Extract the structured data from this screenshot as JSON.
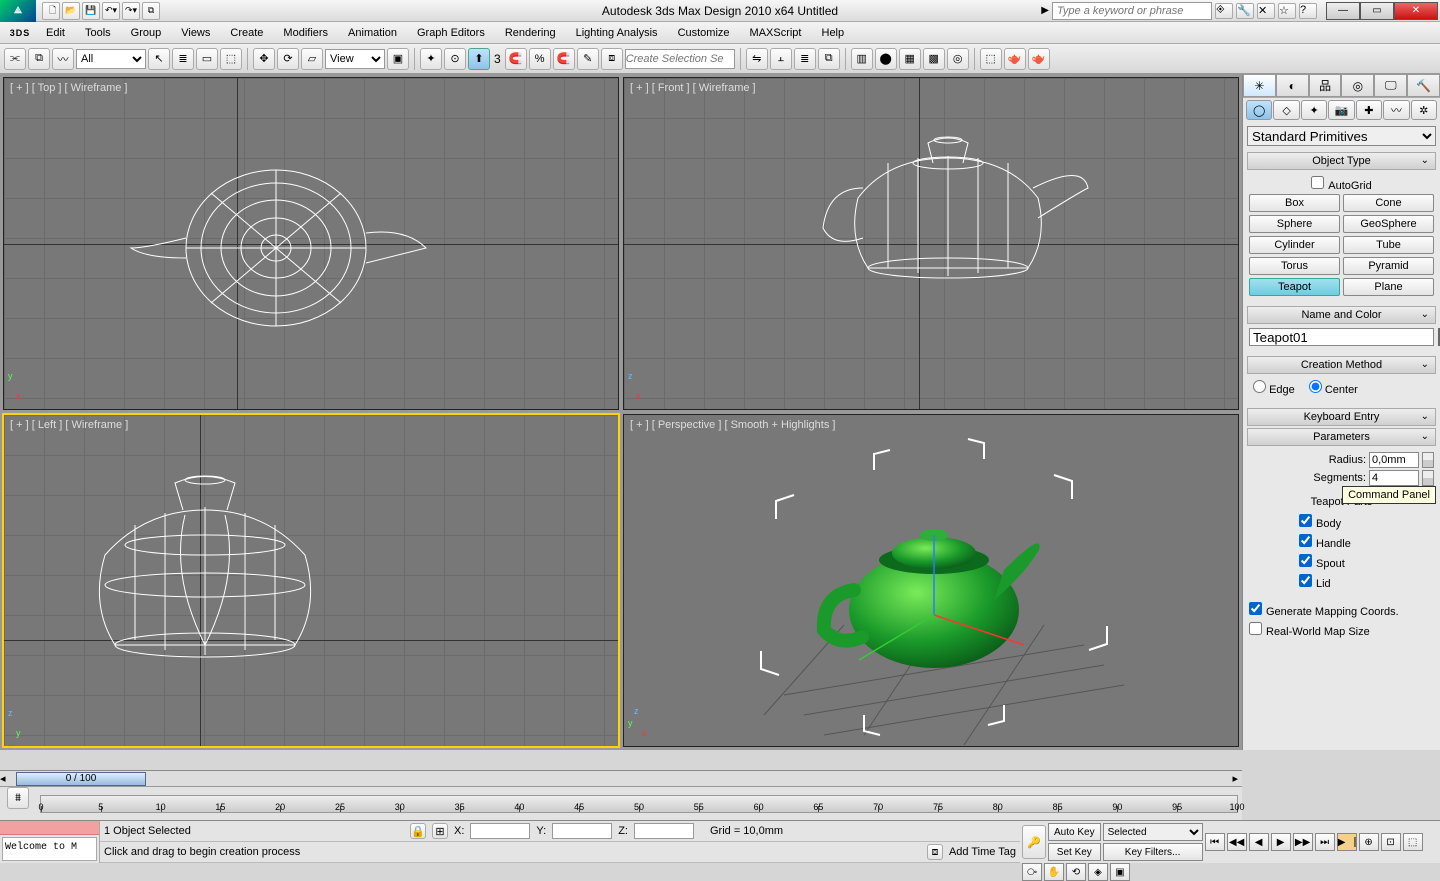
{
  "title": "Autodesk 3ds Max Design 2010 x64      Untitled",
  "search_placeholder": "Type a keyword or phrase",
  "logo": "3DS",
  "menu": [
    "Edit",
    "Tools",
    "Group",
    "Views",
    "Create",
    "Modifiers",
    "Animation",
    "Graph Editors",
    "Rendering",
    "Lighting Analysis",
    "Customize",
    "MAXScript",
    "Help"
  ],
  "toolbar": {
    "filter_select": "All",
    "view_select": "View",
    "three": "3",
    "selection_placeholder": "Create Selection Se"
  },
  "viewports": {
    "top": "[ + ] [ Top ] [ Wireframe ]",
    "front": "[ + ] [ Front ] [ Wireframe ]",
    "left": "[ + ] [ Left ] [ Wireframe ]",
    "persp": "[ + ] [ Perspective ] [ Smooth + Highlights ]"
  },
  "cmd": {
    "category": "Standard Primitives",
    "rollout_object_type": "Object Type",
    "autogrid": "AutoGrid",
    "objects": [
      "Box",
      "Cone",
      "Sphere",
      "GeoSphere",
      "Cylinder",
      "Tube",
      "Torus",
      "Pyramid",
      "Teapot",
      "Plane"
    ],
    "rollout_name": "Name and Color",
    "name_value": "Teapot01",
    "rollout_creation": "Creation Method",
    "radio_edge": "Edge",
    "radio_center": "Center",
    "rollout_keyboard": "Keyboard Entry",
    "rollout_params": "Parameters",
    "radius_label": "Radius:",
    "radius_value": "0,0mm",
    "segments_label": "Segments:",
    "segments_value": "4",
    "tooltip": "Command Panel",
    "teapot_parts_title": "Teapot Parts",
    "part_body": "Body",
    "part_handle": "Handle",
    "part_spout": "Spout",
    "part_lid": "Lid",
    "gen_mapping": "Generate Mapping Coords.",
    "real_world": "Real-World Map Size"
  },
  "track": {
    "slider": "0 / 100",
    "ticks": [
      0,
      5,
      10,
      15,
      20,
      25,
      30,
      35,
      40,
      45,
      50,
      55,
      60,
      65,
      70,
      75,
      80,
      85,
      90,
      95,
      100
    ]
  },
  "status": {
    "welcome": "Welcome to M",
    "selected": "1 Object Selected",
    "prompt": "Click and drag to begin creation process",
    "x": "X:",
    "y": "Y:",
    "z": "Z:",
    "grid": "Grid = 10,0mm",
    "add_time_tag": "Add Time Tag",
    "auto_key": "Auto Key",
    "set_key": "Set Key",
    "key_filters": "Key Filters...",
    "selected_combo": "Selected"
  }
}
